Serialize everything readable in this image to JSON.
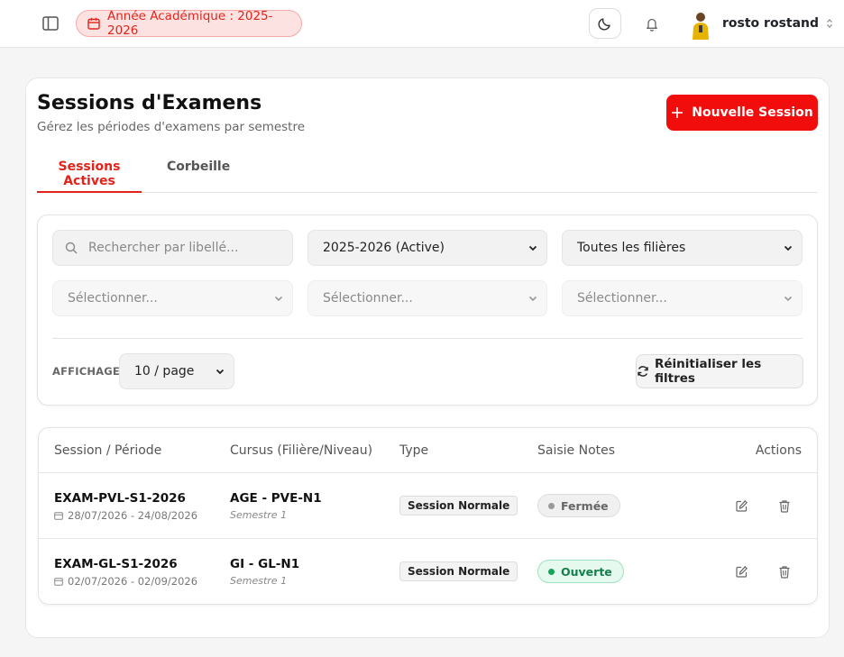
{
  "topbar": {
    "academic_year": "Année Académique : 2025-2026",
    "user_name": "rosto rostand"
  },
  "page": {
    "title": "Sessions d'Examens",
    "subtitle": "Gérez les périodes d'examens par semestre",
    "new_button": "Nouvelle Session"
  },
  "tabs": [
    {
      "label": "Sessions Actives",
      "active": true
    },
    {
      "label": "Corbeille",
      "active": false
    }
  ],
  "filters": {
    "search_placeholder": "Rechercher par libellé...",
    "year_select": "2025-2026 (Active)",
    "filiere_select": "Toutes les filières",
    "select_a": "Sélectionner...",
    "select_b": "Sélectionner...",
    "select_c": "Sélectionner...",
    "display_label": "AFFICHAGE",
    "page_size": "10 / page",
    "reset_button": "Réinitialiser les filtres"
  },
  "table": {
    "headers": [
      "Session / Période",
      "Cursus (Filière/Niveau)",
      "Type",
      "Saisie Notes",
      "Actions"
    ],
    "rows": [
      {
        "code": "EXAM-PVL-S1-2026",
        "dates": "28/07/2026 - 24/08/2026",
        "cursus": "AGE - PVE-N1",
        "semester": "Semestre 1",
        "type": "Session Normale",
        "status": "Fermée"
      },
      {
        "code": "EXAM-GL-S1-2026",
        "dates": "02/07/2026 - 02/09/2026",
        "cursus": "GI - GL-N1",
        "semester": "Semestre 1",
        "type": "Session Normale",
        "status": "Ouverte"
      }
    ]
  },
  "colors": {
    "accent": "#f20d0d",
    "open_status": "#16a35a",
    "closed_status": "#999999"
  }
}
